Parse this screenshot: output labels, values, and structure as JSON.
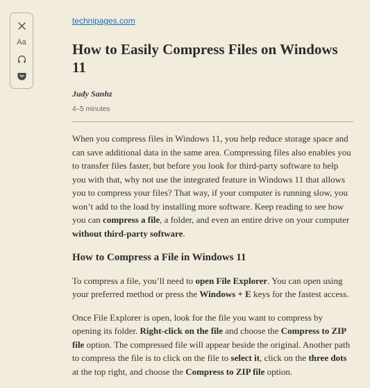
{
  "toolbar": {
    "type_label": "Aa"
  },
  "site": {
    "link_text": "technipages.com"
  },
  "article": {
    "title": "How to Easily Compress Files on Windows 11",
    "author": "Judy Sanhz",
    "duration": "4–5 minutes",
    "p1_a": "When you compress files in Windows 11, you help reduce storage space and can save additional data in the same area. Compressing files also enables you to transfer files faster, but before you look for third-party software to help you with that, why not use the integrated feature in Windows 11 that allows you to compress your files? That way, if your computer is running slow, you won’t add to the load by installing more software. Keep reading to see how you can ",
    "p1_b1": "compress a file",
    "p1_c": ", a folder, and even an entire drive on your computer ",
    "p1_b2": "without third-party software",
    "p1_d": ".",
    "h2": "How to Compress a File in Windows 11",
    "p2_a": "To compress a file, you’ll need to ",
    "p2_b1": "open File Explorer",
    "p2_c": ". You can open using your preferred method or press the ",
    "p2_b2": "Windows + E",
    "p2_d": " keys for the fastest access.",
    "p3_a": "Once File Explorer is open, look for the file you want to compress by opening its folder. ",
    "p3_b1": "Right-click on the file",
    "p3_c": " and choose the ",
    "p3_b2": "Compress to ZIP file",
    "p3_d": " option. The compressed file will appear beside the original. Another path to compress the file is to click on the file to ",
    "p3_b3": "select it",
    "p3_e": ", click on the ",
    "p3_b4": "three dots",
    "p3_f": " at the top right, and choose the ",
    "p3_b5": "Compress to ZIP file",
    "p3_g": " option."
  }
}
